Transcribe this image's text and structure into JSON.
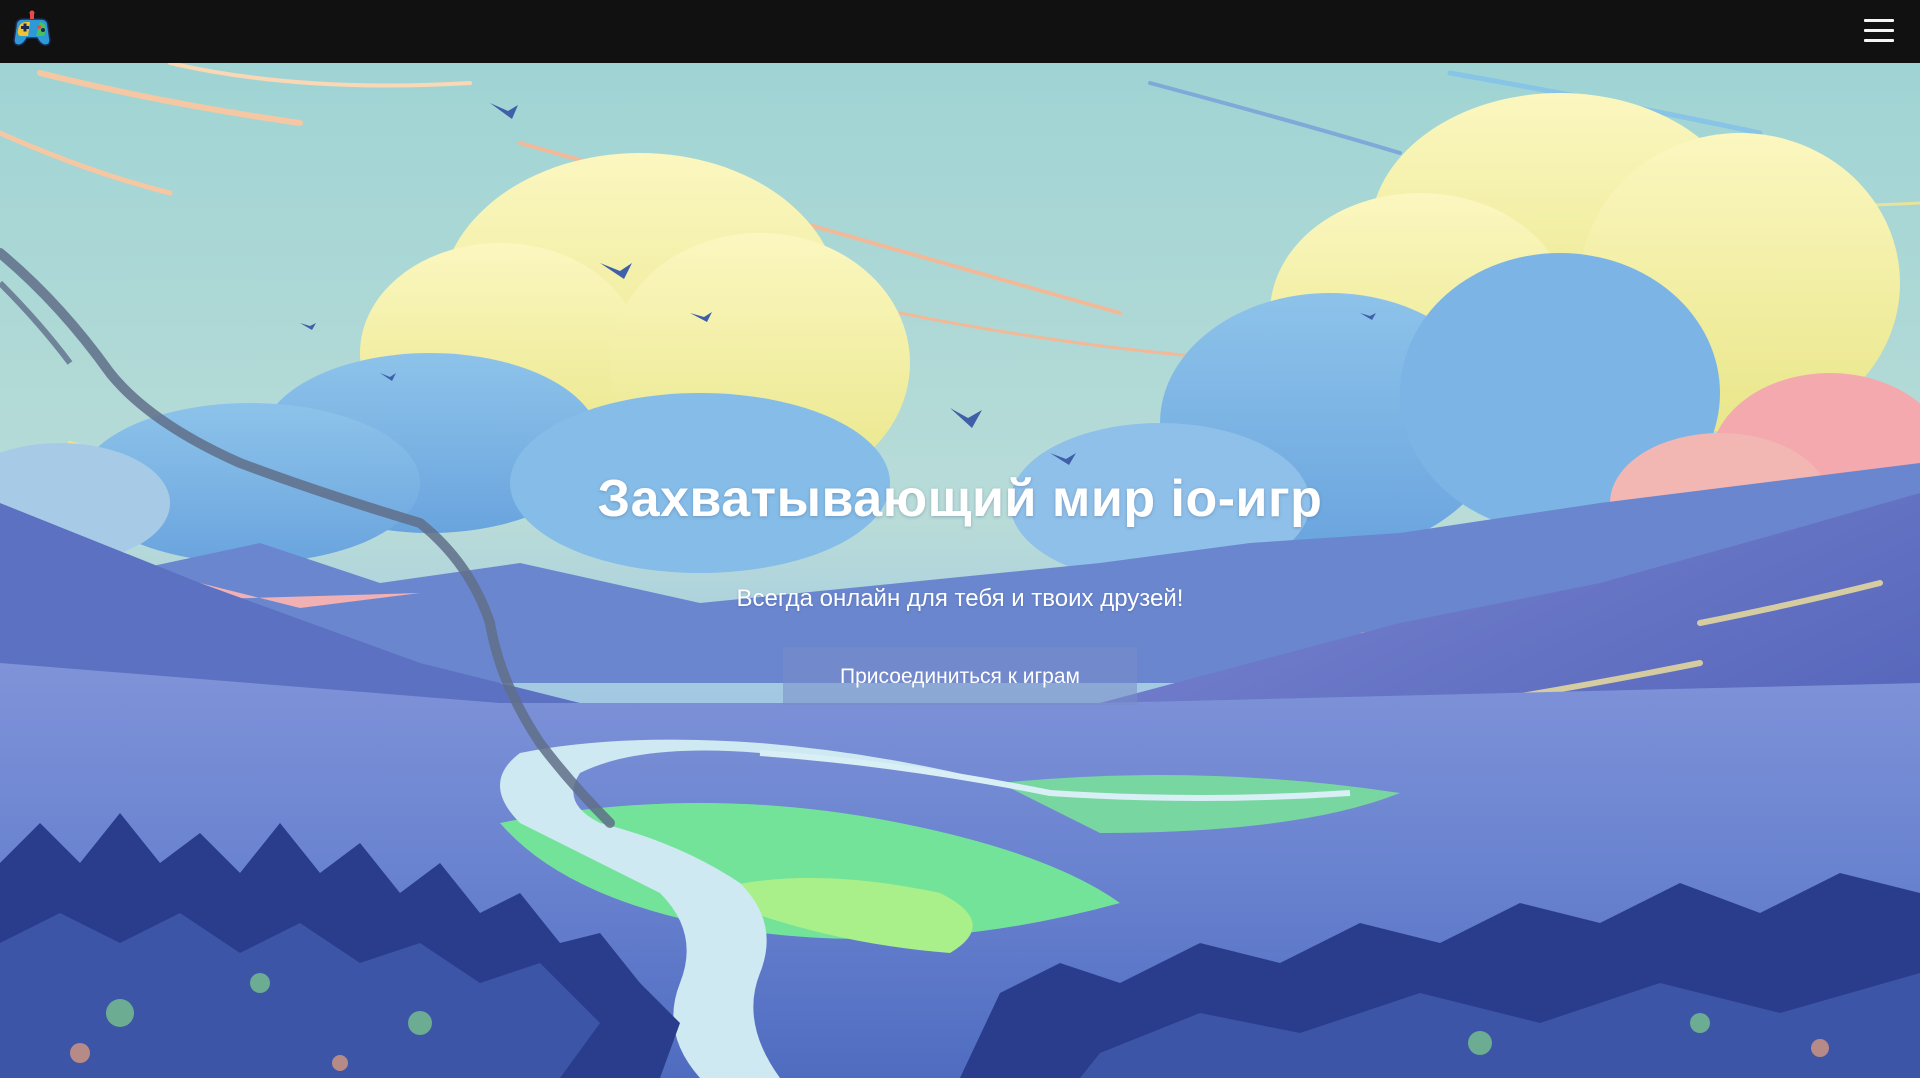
{
  "header": {
    "logo_icon": "gamepad-icon",
    "menu_icon": "hamburger-menu-icon"
  },
  "hero": {
    "title": "Захватывающий мир io-игр",
    "subtitle": "Всегда онлайн для тебя и твоих друзей!",
    "join_button_label": "Присоединиться к играм"
  },
  "colors": {
    "topbar": "#111111",
    "sky": "#a9d6d9",
    "cloud_yellow": "#f4ef9e",
    "cloud_blue": "#7fb6e6",
    "cloud_pink": "#f0a3a9",
    "mountains": "#5067b8",
    "valley_green": "#6fe08a",
    "river": "#cfe9f2",
    "forest": "#283a8a",
    "button_bg": "rgba(120,140,200,0.55)",
    "text": "#ffffff"
  }
}
